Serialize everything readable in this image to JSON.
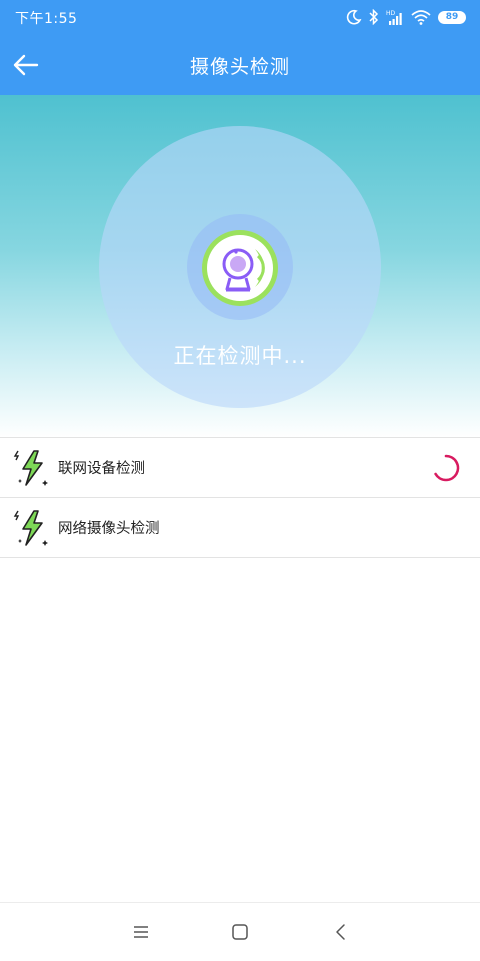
{
  "status_bar": {
    "time": "下午1:55",
    "battery": "89"
  },
  "app_bar": {
    "title": "摄像头检测",
    "back_icon": "arrow-left-icon"
  },
  "scan": {
    "status_text": "正在检测中...",
    "icon": "camera-scan-icon"
  },
  "checks": [
    {
      "label": "联网设备检测",
      "icon": "lightning-icon",
      "state": "loading"
    },
    {
      "label": "网络摄像头检测",
      "icon": "lightning-icon",
      "state": "pending"
    }
  ],
  "nav": {
    "menu_icon": "menu-icon",
    "home_icon": "home-square-icon",
    "back_icon": "chevron-left-icon"
  },
  "colors": {
    "primary": "#3e9bf4",
    "hero_top": "#4fc1d0",
    "spinner": "#d81b60",
    "camera_green": "#9be15d",
    "camera_purple": "#8a5cf6"
  }
}
